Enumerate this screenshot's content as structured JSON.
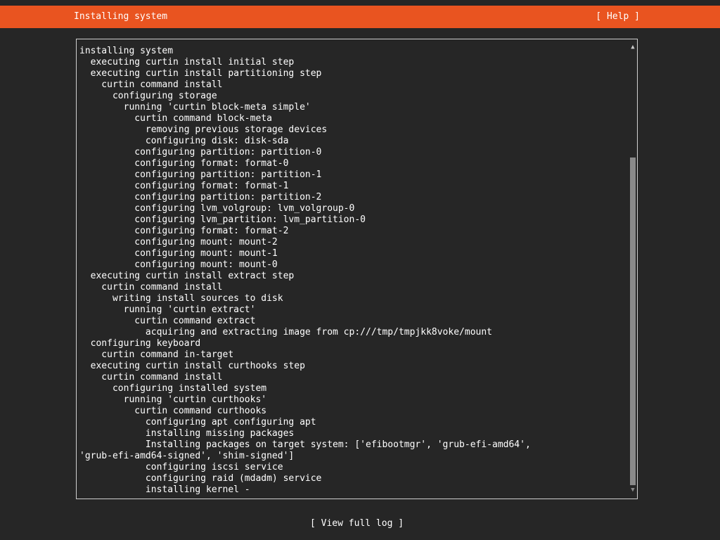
{
  "header": {
    "title": "Installing system",
    "help_label": "[ Help ]"
  },
  "log": {
    "lines": [
      "installing system",
      "  executing curtin install initial step",
      "  executing curtin install partitioning step",
      "    curtin command install",
      "      configuring storage",
      "        running 'curtin block-meta simple'",
      "          curtin command block-meta",
      "            removing previous storage devices",
      "            configuring disk: disk-sda",
      "          configuring partition: partition-0",
      "          configuring format: format-0",
      "          configuring partition: partition-1",
      "          configuring format: format-1",
      "          configuring partition: partition-2",
      "          configuring lvm_volgroup: lvm_volgroup-0",
      "          configuring lvm_partition: lvm_partition-0",
      "          configuring format: format-2",
      "          configuring mount: mount-2",
      "          configuring mount: mount-1",
      "          configuring mount: mount-0",
      "  executing curtin install extract step",
      "    curtin command install",
      "      writing install sources to disk",
      "        running 'curtin extract'",
      "          curtin command extract",
      "            acquiring and extracting image from cp:///tmp/tmpjkk8voke/mount",
      "  configuring keyboard",
      "    curtin command in-target",
      "  executing curtin install curthooks step",
      "    curtin command install",
      "      configuring installed system",
      "        running 'curtin curthooks'",
      "          curtin command curthooks",
      "            configuring apt configuring apt",
      "            installing missing packages",
      "            Installing packages on target system: ['efibootmgr', 'grub-efi-amd64',",
      "'grub-efi-amd64-signed', 'shim-signed']",
      "            configuring iscsi service",
      "            configuring raid (mdadm) service",
      "            installing kernel -"
    ]
  },
  "scrollbar": {
    "up_icon": "▲",
    "down_icon": "▼"
  },
  "footer": {
    "view_log_label": "[ View full log ]"
  },
  "colors": {
    "accent": "#e95420",
    "background": "#262626",
    "text": "#ffffff"
  }
}
